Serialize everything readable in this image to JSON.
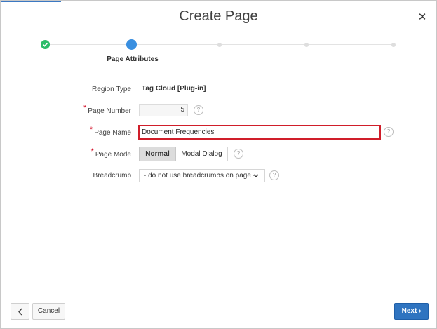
{
  "dialog": {
    "title": "Create Page",
    "close_icon": "close-icon",
    "accent_color": "#3b78c2"
  },
  "wizard": {
    "steps": [
      {
        "status": "complete",
        "icon": "check-icon"
      },
      {
        "status": "current",
        "label": "Page Attributes"
      },
      {
        "status": "pending"
      },
      {
        "status": "pending"
      },
      {
        "status": "pending"
      }
    ]
  },
  "form": {
    "region_type": {
      "label": "Region Type",
      "value": "Tag Cloud [Plug-in]"
    },
    "page_number": {
      "label": "Page Number",
      "value": "5",
      "required": true
    },
    "page_name": {
      "label": "Page Name",
      "value": "Document Frequencies",
      "required": true
    },
    "page_mode": {
      "label": "Page Mode",
      "options": [
        "Normal",
        "Modal Dialog"
      ],
      "selected": "Normal",
      "required": true
    },
    "breadcrumb": {
      "label": "Breadcrumb",
      "value": "- do not use breadcrumbs on page -"
    },
    "required_marker": "*",
    "help_glyph": "?"
  },
  "footer": {
    "back_icon": "chevron-left-icon",
    "cancel_label": "Cancel",
    "next_label": "Next"
  },
  "colors": {
    "primary": "#2f74c0",
    "complete": "#2ebc6a",
    "current": "#3a8fe0",
    "error_border": "#d01e2a"
  }
}
